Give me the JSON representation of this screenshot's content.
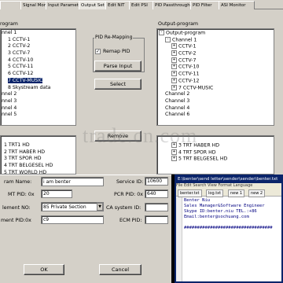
{
  "tabs": [
    "",
    "Signal Monitor",
    "Input Parameter",
    "Output Set",
    "Edit NIT",
    "Edit PSI",
    "PID Passthrough",
    "PID Filter",
    "ASI Monitor"
  ],
  "input_tree": {
    "header": "rogram",
    "items": [
      {
        "text": "nnel 1",
        "selected": false
      },
      {
        "text": "1 CCTV-1",
        "selected": false
      },
      {
        "text": "2 CCTV-2",
        "selected": false
      },
      {
        "text": "3 CCTV-7",
        "selected": false
      },
      {
        "text": "4 CCTV-10",
        "selected": false
      },
      {
        "text": "5 CCTV-11",
        "selected": false
      },
      {
        "text": "6 CCTV-12",
        "selected": false
      },
      {
        "text": "7 CCTV-MUSIC",
        "selected": true
      },
      {
        "text": "8 Skystream data",
        "selected": false
      },
      {
        "text": "nnel 2",
        "selected": false
      },
      {
        "text": "nnel 3",
        "selected": false
      },
      {
        "text": "nnel 4",
        "selected": false
      },
      {
        "text": "nnel 5",
        "selected": false
      }
    ],
    "items2": [
      "1 TRT1 HD",
      "2 TRT HABER HD",
      "3 TRT SPOR HD",
      "4 TRT BELGESEL HD",
      "5 TRT WORLD HD"
    ]
  },
  "pid_remapping": {
    "title": "PID Re-Mapping",
    "remap_label": "Remap PID",
    "remap_checked": true,
    "parse_input": "Parse Input",
    "select": "Select",
    "remove": "Remove"
  },
  "output_tree": {
    "header": "Output-program",
    "items": [
      {
        "text": "Output-program",
        "exp": "-",
        "level": 0
      },
      {
        "text": "Channel 1",
        "exp": "-",
        "level": 1
      },
      {
        "text": "CCTV-1",
        "exp": "+",
        "level": 2
      },
      {
        "text": "CCTV-2",
        "exp": "+",
        "level": 2
      },
      {
        "text": "CCTV-7",
        "exp": "+",
        "level": 2
      },
      {
        "text": "CCTV-10",
        "exp": "+",
        "level": 2
      },
      {
        "text": "CCTV-11",
        "exp": "+",
        "level": 2
      },
      {
        "text": "CCTV-12",
        "exp": "+",
        "level": 2
      },
      {
        "text": "7 CCTV-MUSIC",
        "exp": "+",
        "level": 2
      },
      {
        "text": "Channel 2",
        "exp": "",
        "level": 1
      },
      {
        "text": "Channel 3",
        "exp": "",
        "level": 1
      },
      {
        "text": "Channel 4",
        "exp": "",
        "level": 1
      },
      {
        "text": "Channel 6",
        "exp": "",
        "level": 1
      }
    ],
    "items2": [
      {
        "text": "3 TRT HABER HD",
        "exp": "+"
      },
      {
        "text": "4 TRT SPOR HD",
        "exp": "+"
      },
      {
        "text": "5 TRT BELGESEL HD",
        "exp": "+"
      }
    ]
  },
  "form": {
    "program_name_label": "ram Name:",
    "program_name_value": "i am benter",
    "pmt_pid_label": "MT PID: 0x",
    "pmt_pid_value": "20",
    "element_no_label": "lement NO:",
    "element_no_value": "85 Private Section",
    "element_pid_label": "ment PID:0x",
    "element_pid_value": "c9",
    "service_id_label": "Service ID:",
    "service_id_value": "10600",
    "pcr_pid_label": "PCR PID: 0x",
    "pcr_pid_value": "640",
    "ca_system_label": "CA system ID:",
    "ecm_pid_label": "ECM PID:",
    "ok": "OK",
    "cancel": "Cancel"
  },
  "notepad": {
    "title": "E:\\benter\\send letter\\sender\\sender\\benter.txt",
    "menu": "File  Edit  Search  View  Format  Language",
    "tabs": [
      "benter.txt",
      "log.txt",
      "new 1",
      "new 2"
    ],
    "lines": [
      "Benter Niu",
      "Sales Manager&Software Engineer",
      "Skype ID:benter.niu    TEL.:+86",
      "Email:benter@sochuang.com",
      "",
      "##################################"
    ]
  },
  "watermark": "trade.cn.com"
}
